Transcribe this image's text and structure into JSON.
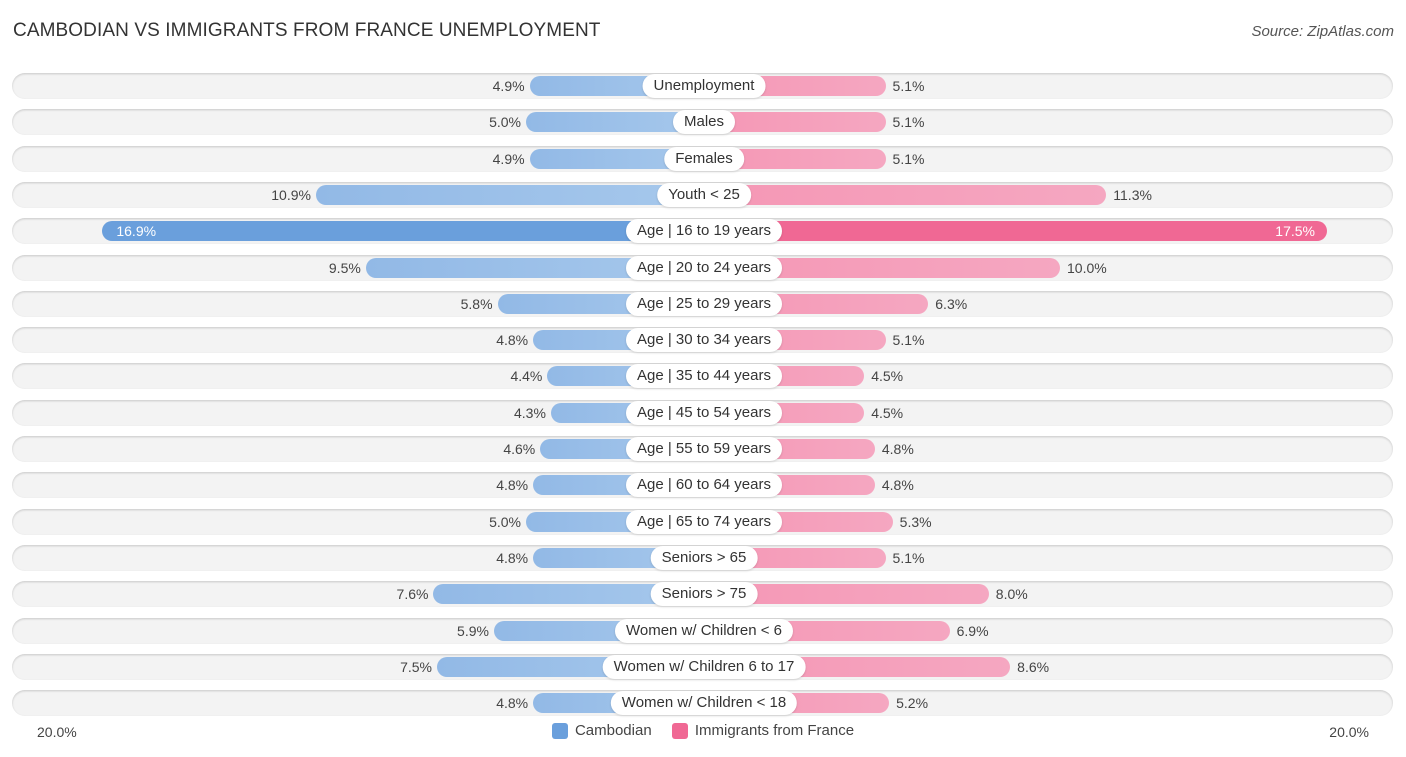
{
  "title": "CAMBODIAN VS IMMIGRANTS FROM FRANCE UNEMPLOYMENT",
  "source": "Source: ZipAtlas.com",
  "colors": {
    "cambodian": "#6a9fdc",
    "immigrants_from_france": "#f06894"
  },
  "chart_data": {
    "type": "bar",
    "orientation": "horizontal-diverging",
    "title": "CAMBODIAN VS IMMIGRANTS FROM FRANCE UNEMPLOYMENT",
    "xlabel": "",
    "ylabel": "",
    "xlim": [
      -20,
      20
    ],
    "axis_labels": {
      "left": "20.0%",
      "right": "20.0%"
    },
    "legend": {
      "position": "bottom-center",
      "entries": [
        "Cambodian",
        "Immigrants from France"
      ]
    },
    "categories": [
      "Unemployment",
      "Males",
      "Females",
      "Youth < 25",
      "Age | 16 to 19 years",
      "Age | 20 to 24 years",
      "Age | 25 to 29 years",
      "Age | 30 to 34 years",
      "Age | 35 to 44 years",
      "Age | 45 to 54 years",
      "Age | 55 to 59 years",
      "Age | 60 to 64 years",
      "Age | 65 to 74 years",
      "Seniors > 65",
      "Seniors > 75",
      "Women w/ Children < 6",
      "Women w/ Children 6 to 17",
      "Women w/ Children < 18"
    ],
    "series": [
      {
        "name": "Cambodian",
        "side": "left",
        "values": [
          4.9,
          5.0,
          4.9,
          10.9,
          16.9,
          9.5,
          5.8,
          4.8,
          4.4,
          4.3,
          4.6,
          4.8,
          5.0,
          4.8,
          7.6,
          5.9,
          7.5,
          4.8
        ],
        "labels": [
          "4.9%",
          "5.0%",
          "4.9%",
          "10.9%",
          "16.9%",
          "9.5%",
          "5.8%",
          "4.8%",
          "4.4%",
          "4.3%",
          "4.6%",
          "4.8%",
          "5.0%",
          "4.8%",
          "7.6%",
          "5.9%",
          "7.5%",
          "4.8%"
        ]
      },
      {
        "name": "Immigrants from France",
        "side": "right",
        "values": [
          5.1,
          5.1,
          5.1,
          11.3,
          17.5,
          10.0,
          6.3,
          5.1,
          4.5,
          4.5,
          4.8,
          4.8,
          5.3,
          5.1,
          8.0,
          6.9,
          8.6,
          5.2
        ],
        "labels": [
          "5.1%",
          "5.1%",
          "5.1%",
          "11.3%",
          "17.5%",
          "10.0%",
          "6.3%",
          "5.1%",
          "4.5%",
          "4.5%",
          "4.8%",
          "4.8%",
          "5.3%",
          "5.1%",
          "8.0%",
          "6.9%",
          "8.6%",
          "5.2%"
        ]
      }
    ],
    "highlighted_category": "Age | 16 to 19 years"
  }
}
